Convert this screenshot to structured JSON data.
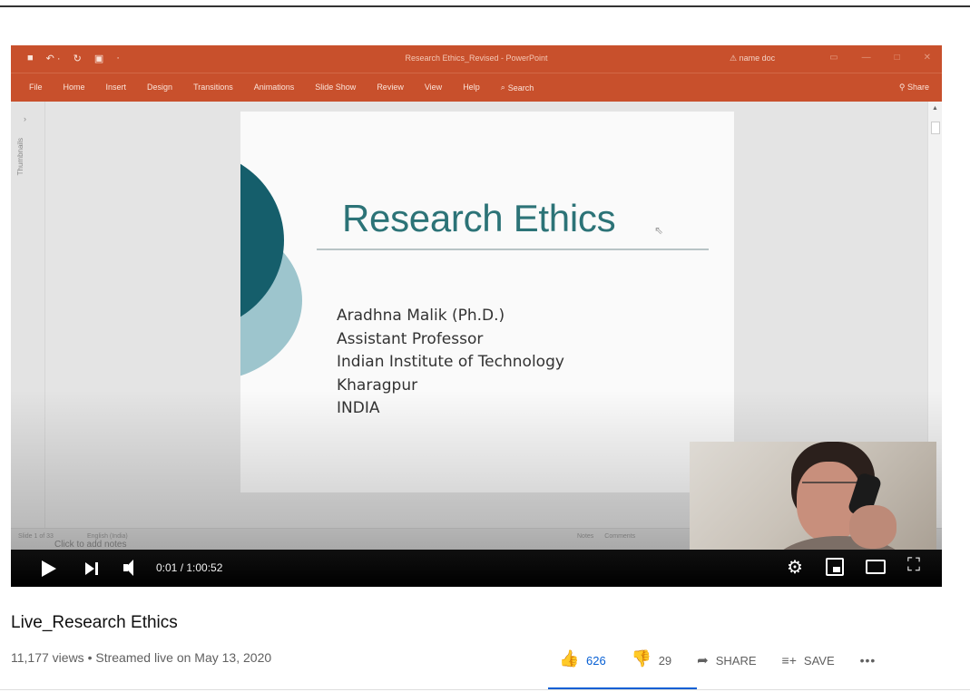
{
  "ppt": {
    "qat": [
      "■",
      "↶ ·",
      "↻",
      "▣",
      "·"
    ],
    "doc_title": "Research Ethics_Revised - PowerPoint",
    "user": "⚠ name doc",
    "tabs": [
      "File",
      "Home",
      "Insert",
      "Design",
      "Transitions",
      "Animations",
      "Slide Show",
      "Review",
      "View",
      "Help"
    ],
    "search": "Search",
    "share": "Share",
    "thumbnails_label": "Thumbnails",
    "notes_placeholder": "Click to add notes",
    "status_left": "Slide 1 of 33",
    "status_lang": "English (India)",
    "status_notes": "Notes",
    "status_comments": "Comments"
  },
  "slide": {
    "title": "Research Ethics",
    "author_lines": [
      "Aradhna Malik (Ph.D.)",
      "Assistant Professor",
      "Indian Institute of Technology",
      "Kharagpur",
      "INDIA"
    ]
  },
  "player": {
    "time": "0:01 / 1:00:52"
  },
  "video": {
    "title": "Live_Research Ethics",
    "meta": "11,177 views • Streamed live on May 13, 2020",
    "likes": "626",
    "dislikes": "29",
    "share_label": "SHARE",
    "save_label": "SAVE"
  },
  "colors": {
    "ppt_orange": "#c8502c",
    "slide_title_teal": "#2c7377",
    "youtube_blue": "#065fd4"
  }
}
